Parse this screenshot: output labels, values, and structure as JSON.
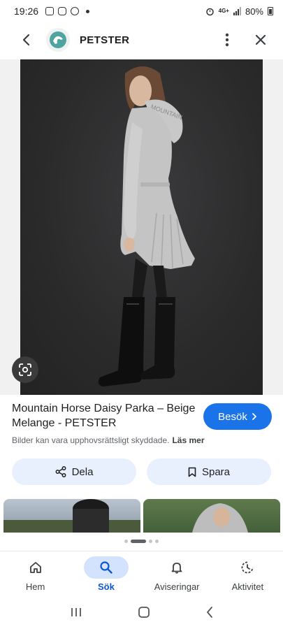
{
  "status": {
    "time": "19:26",
    "network": "4G+",
    "battery": "80%"
  },
  "header": {
    "site_name": "PETSTER"
  },
  "result": {
    "title": "Mountain Horse Daisy Parka – Beige Melange - PETSTER",
    "visit_label": "Besök",
    "copyright_text": "Bilder kan vara upphovsrättsligt skyddade.",
    "learn_more": "Läs mer",
    "hood_text": "MOUNTAIN"
  },
  "actions": {
    "share_label": "Dela",
    "save_label": "Spara"
  },
  "nav": {
    "items": [
      {
        "label": "Hem",
        "icon": "home-icon",
        "active": false
      },
      {
        "label": "Sök",
        "icon": "search-icon",
        "active": true
      },
      {
        "label": "Aviseringar",
        "icon": "bell-icon",
        "active": false
      },
      {
        "label": "Aktivitet",
        "icon": "activity-icon",
        "active": false
      }
    ]
  },
  "colors": {
    "accent": "#1a73e8",
    "chip_bg": "#e8f0fe",
    "active_nav": "#0b57d0",
    "photo_bg": "#2a2a2b"
  }
}
